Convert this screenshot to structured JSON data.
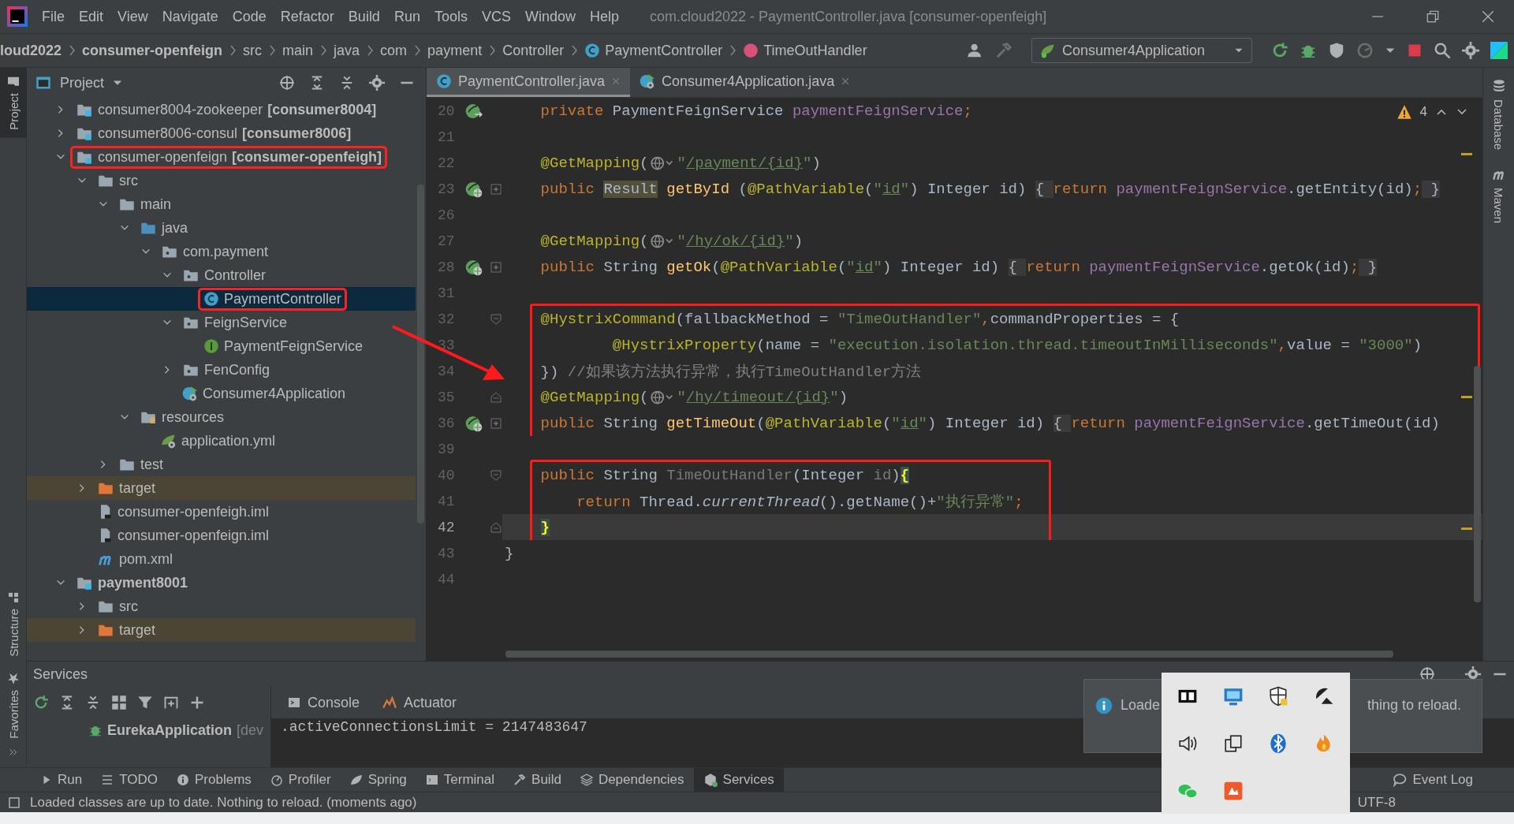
{
  "menu_bar": {
    "menus": [
      "File",
      "Edit",
      "View",
      "Navigate",
      "Code",
      "Refactor",
      "Build",
      "Run",
      "Tools",
      "VCS",
      "Window",
      "Help"
    ],
    "title": "com.cloud2022 - PaymentController.java [consumer-openfeigh]"
  },
  "breadcrumbs": [
    {
      "label": "loud2022",
      "kind": "project"
    },
    {
      "label": "consumer-openfeign",
      "kind": "project"
    },
    {
      "label": "src",
      "kind": "dir"
    },
    {
      "label": "main",
      "kind": "dir"
    },
    {
      "label": "java",
      "kind": "dir"
    },
    {
      "label": "com",
      "kind": "dir"
    },
    {
      "label": "payment",
      "kind": "dir"
    },
    {
      "label": "Controller",
      "kind": "dir"
    },
    {
      "label": "PaymentController",
      "kind": "class"
    },
    {
      "label": "TimeOutHandler",
      "kind": "method"
    }
  ],
  "run_config": {
    "label": "Consumer4Application"
  },
  "side_tabs": {
    "left_top": [
      {
        "label": "Project",
        "selected": true
      }
    ],
    "left_bottom": [
      {
        "label": "Structure",
        "kind": "structure"
      },
      {
        "label": "Favorites",
        "kind": "favorites"
      }
    ],
    "right": [
      {
        "label": "Database",
        "kind": "database"
      },
      {
        "label": "Maven",
        "kind": "maven"
      }
    ]
  },
  "project_panel": {
    "title": "Project",
    "tree": [
      {
        "label": "consumer8004-zookeeper",
        "suffix": "[consumer8004]",
        "kind": "module",
        "expanded": false,
        "selected": false,
        "annotated": false,
        "bold": false
      },
      {
        "label": "consumer8006-consul",
        "suffix": "[consumer8006]",
        "kind": "module",
        "expanded": false,
        "selected": false,
        "annotated": false,
        "bold": false
      },
      {
        "label": "consumer-openfeign",
        "suffix": "[consumer-openfeigh]",
        "kind": "module",
        "expanded": true,
        "selected": false,
        "annotated": true,
        "bold": false,
        "children": [
          {
            "label": "src",
            "kind": "folder",
            "expanded": true,
            "selected": false,
            "annotated": false,
            "bold": false,
            "children": [
              {
                "label": "main",
                "kind": "folder",
                "expanded": true,
                "selected": false,
                "annotated": false,
                "bold": false,
                "children": [
                  {
                    "label": "java",
                    "kind": "source",
                    "expanded": true,
                    "selected": false,
                    "annotated": false,
                    "bold": false,
                    "children": [
                      {
                        "label": "com.payment",
                        "kind": "package",
                        "expanded": true,
                        "selected": false,
                        "annotated": false,
                        "bold": false,
                        "children": [
                          {
                            "label": "Controller",
                            "kind": "package",
                            "expanded": true,
                            "selected": false,
                            "annotated": false,
                            "bold": false,
                            "children": [
                              {
                                "label": "PaymentController",
                                "kind": "class",
                                "selected": true,
                                "annotated": true,
                                "bold": false
                              }
                            ]
                          },
                          {
                            "label": "FeignService",
                            "kind": "package",
                            "expanded": true,
                            "selected": false,
                            "annotated": false,
                            "bold": false,
                            "children": [
                              {
                                "label": "PaymentFeignService",
                                "kind": "interface",
                                "selected": false,
                                "annotated": false,
                                "bold": false
                              }
                            ]
                          },
                          {
                            "label": "FenConfig",
                            "kind": "package",
                            "expanded": false,
                            "selected": false,
                            "annotated": false,
                            "bold": false
                          },
                          {
                            "label": "Consumer4Application",
                            "kind": "spring-app",
                            "selected": false,
                            "annotated": false,
                            "bold": false
                          }
                        ]
                      }
                    ]
                  },
                  {
                    "label": "resources",
                    "kind": "resources",
                    "expanded": true,
                    "selected": false,
                    "annotated": false,
                    "bold": false,
                    "children": [
                      {
                        "label": "application.yml",
                        "kind": "yml",
                        "selected": false,
                        "annotated": false,
                        "bold": false
                      }
                    ]
                  }
                ]
              },
              {
                "label": "test",
                "kind": "folder",
                "expanded": false,
                "selected": false,
                "annotated": false,
                "bold": false
              }
            ]
          },
          {
            "label": "target",
            "kind": "excluded",
            "expanded": false,
            "selected": false,
            "annotated": false,
            "bold": false
          },
          {
            "label": "consumer-openfeigh.iml",
            "kind": "iml",
            "selected": false,
            "annotated": false,
            "bold": false
          },
          {
            "label": "consumer-openfeign.iml",
            "kind": "iml",
            "selected": false,
            "annotated": false,
            "bold": false
          },
          {
            "label": "pom.xml",
            "kind": "maven",
            "selected": false,
            "annotated": false,
            "bold": false
          }
        ]
      },
      {
        "label": "payment8001",
        "kind": "module",
        "expanded": true,
        "selected": false,
        "annotated": false,
        "bold": true,
        "children": [
          {
            "label": "src",
            "kind": "folder",
            "expanded": false,
            "selected": false,
            "annotated": false,
            "bold": false
          },
          {
            "label": "target",
            "kind": "excluded",
            "expanded": false,
            "selected": false,
            "annotated": false,
            "bold": false
          }
        ]
      }
    ]
  },
  "editor": {
    "tabs": [
      {
        "label": "PaymentController.java",
        "kind": "class",
        "selected": true
      },
      {
        "label": "Consumer4Application.java",
        "kind": "spring-app",
        "selected": false
      }
    ],
    "warnings": "4",
    "blocks": [
      {
        "kind": "plain",
        "lines": [
          {
            "number": "20",
            "gutter_icon": {
              "kind": "bean-arrow"
            },
            "current": false,
            "tokens": [
              {
                "text": "    private ",
                "kind": "kw"
              },
              {
                "text": "PaymentFeignService ",
                "kind": "plain"
              },
              {
                "text": "paymentFeignService",
                "kind": "field"
              },
              {
                "text": ";",
                "kind": "kw"
              }
            ]
          },
          {
            "number": "21",
            "current": false
          },
          {
            "number": "22",
            "current": false,
            "tokens": [
              {
                "text": "    @GetMapping",
                "kind": "ann"
              },
              {
                "text": "(",
                "kind": "plain"
              },
              {
                "kind": "globe"
              },
              {
                "text": "\"",
                "kind": "str"
              },
              {
                "text": "/payment/{id}",
                "kind": "url"
              },
              {
                "text": "\"",
                "kind": "str"
              },
              {
                "text": ")",
                "kind": "plain"
              }
            ]
          },
          {
            "number": "23",
            "gutter_icon": {
              "kind": "bean"
            },
            "fold_marker": {
              "kind": "plus"
            },
            "current": false,
            "tokens": [
              {
                "text": "    public ",
                "kind": "kw"
              },
              {
                "text": "Result",
                "kind": "hl"
              },
              {
                "text": " getById ",
                "kind": "method"
              },
              {
                "text": "(",
                "kind": "plain"
              },
              {
                "text": "@PathVariable",
                "kind": "ann"
              },
              {
                "text": "(",
                "kind": "plain"
              },
              {
                "text": "\"",
                "kind": "str"
              },
              {
                "text": "id",
                "kind": "url"
              },
              {
                "text": "\"",
                "kind": "str"
              },
              {
                "text": ") Integer id) ",
                "kind": "plain"
              },
              {
                "text": "{ ",
                "kind": "fold"
              },
              {
                "text": "return ",
                "kind": "kw"
              },
              {
                "text": "paymentFeignService",
                "kind": "field"
              },
              {
                "text": ".getEntity(id)",
                "kind": "plain"
              },
              {
                "text": ";",
                "kind": "kw"
              },
              {
                "text": " }",
                "kind": "fold"
              }
            ]
          },
          {
            "number": "26",
            "current": false
          },
          {
            "number": "27",
            "current": false,
            "tokens": [
              {
                "text": "    @GetMapping",
                "kind": "ann"
              },
              {
                "text": "(",
                "kind": "plain"
              },
              {
                "kind": "globe"
              },
              {
                "text": "\"",
                "kind": "str"
              },
              {
                "text": "/hy/ok/{id}",
                "kind": "url"
              },
              {
                "text": "\"",
                "kind": "str"
              },
              {
                "text": ")",
                "kind": "plain"
              }
            ]
          },
          {
            "number": "28",
            "gutter_icon": {
              "kind": "bean"
            },
            "fold_marker": {
              "kind": "plus"
            },
            "current": false,
            "tokens": [
              {
                "text": "    public ",
                "kind": "kw"
              },
              {
                "text": "String ",
                "kind": "plain"
              },
              {
                "text": "getOk",
                "kind": "method"
              },
              {
                "text": "(",
                "kind": "plain"
              },
              {
                "text": "@PathVariable",
                "kind": "ann"
              },
              {
                "text": "(",
                "kind": "plain"
              },
              {
                "text": "\"",
                "kind": "str"
              },
              {
                "text": "id",
                "kind": "url"
              },
              {
                "text": "\"",
                "kind": "str"
              },
              {
                "text": ") Integer id) ",
                "kind": "plain"
              },
              {
                "text": "{ ",
                "kind": "fold"
              },
              {
                "text": "return ",
                "kind": "kw"
              },
              {
                "text": "paymentFeignService",
                "kind": "field"
              },
              {
                "text": ".getOk(id)",
                "kind": "plain"
              },
              {
                "text": ";",
                "kind": "kw"
              },
              {
                "text": " }",
                "kind": "fold"
              }
            ]
          },
          {
            "number": "31",
            "current": false
          }
        ]
      },
      {
        "kind": "framed-wide",
        "lines": [
          {
            "number": "32",
            "fold_marker": {
              "kind": "start"
            },
            "current": false,
            "tokens": [
              {
                "text": "    @HystrixCommand",
                "kind": "ann"
              },
              {
                "text": "(fallbackMethod = ",
                "kind": "plain"
              },
              {
                "text": "\"TimeOutHandler\"",
                "kind": "str"
              },
              {
                "text": ",",
                "kind": "kw"
              },
              {
                "text": "commandProperties = {",
                "kind": "plain"
              }
            ]
          },
          {
            "number": "33",
            "current": false,
            "tokens": [
              {
                "text": "            @HystrixProperty",
                "kind": "ann"
              },
              {
                "text": "(name = ",
                "kind": "plain"
              },
              {
                "text": "\"execution.isolation.thread.timeoutInMilliseconds\"",
                "kind": "str"
              },
              {
                "text": ",",
                "kind": "kw"
              },
              {
                "text": "value = ",
                "kind": "plain"
              },
              {
                "text": "\"3000\"",
                "kind": "str"
              },
              {
                "text": ")",
                "kind": "plain"
              }
            ]
          },
          {
            "number": "34",
            "current": false,
            "tokens": [
              {
                "text": "    }) ",
                "kind": "plain"
              },
              {
                "text": "//如果该方法执行异常，执行TimeOutHandler方法",
                "kind": "comment"
              }
            ]
          },
          {
            "number": "35",
            "fold_marker": {
              "kind": "end"
            },
            "current": false,
            "tokens": [
              {
                "text": "    @GetMapping",
                "kind": "ann"
              },
              {
                "text": "(",
                "kind": "plain"
              },
              {
                "kind": "globe"
              },
              {
                "text": "\"",
                "kind": "str"
              },
              {
                "text": "/hy/timeout/{id}",
                "kind": "url"
              },
              {
                "text": "\"",
                "kind": "str"
              },
              {
                "text": ")",
                "kind": "plain"
              }
            ]
          },
          {
            "number": "36",
            "gutter_icon": {
              "kind": "bean"
            },
            "fold_marker": {
              "kind": "plus"
            },
            "current": false,
            "tokens": [
              {
                "text": "    public ",
                "kind": "kw"
              },
              {
                "text": "String ",
                "kind": "plain"
              },
              {
                "text": "getTimeOut",
                "kind": "method"
              },
              {
                "text": "(",
                "kind": "plain"
              },
              {
                "text": "@PathVariable",
                "kind": "ann"
              },
              {
                "text": "(",
                "kind": "plain"
              },
              {
                "text": "\"",
                "kind": "str"
              },
              {
                "text": "id",
                "kind": "url"
              },
              {
                "text": "\"",
                "kind": "str"
              },
              {
                "text": ") Integer id) ",
                "kind": "plain"
              },
              {
                "text": "{ ",
                "kind": "fold"
              },
              {
                "text": "return ",
                "kind": "kw"
              },
              {
                "text": "paymentFeignService",
                "kind": "field"
              },
              {
                "text": ".getTimeOut(id)",
                "kind": "plain"
              }
            ]
          }
        ]
      },
      {
        "kind": "plain",
        "lines": [
          {
            "number": "39",
            "current": false
          }
        ]
      },
      {
        "kind": "framed-tight",
        "lines": [
          {
            "number": "40",
            "fold_marker": {
              "kind": "start"
            },
            "current": false,
            "tokens": [
              {
                "text": "    public ",
                "kind": "kw"
              },
              {
                "text": "String ",
                "kind": "plain"
              },
              {
                "text": "TimeOutHandler",
                "kind": "unused"
              },
              {
                "text": "(Integer ",
                "kind": "plain"
              },
              {
                "text": "id",
                "kind": "unused"
              },
              {
                "text": ")",
                "kind": "plain"
              },
              {
                "text": "{",
                "kind": "brace"
              }
            ]
          },
          {
            "number": "41",
            "current": false,
            "tokens": [
              {
                "text": "        return ",
                "kind": "kw"
              },
              {
                "text": "Thread.",
                "kind": "plain"
              },
              {
                "text": "currentThread",
                "kind": "italic"
              },
              {
                "text": "().getName()+",
                "kind": "plain"
              },
              {
                "text": "\"执行异常\"",
                "kind": "str"
              },
              {
                "text": ";",
                "kind": "kw"
              }
            ]
          },
          {
            "number": "42",
            "fold_marker": {
              "kind": "end"
            },
            "current": true,
            "tokens": [
              {
                "text": "    }",
                "kind": "brace"
              }
            ]
          }
        ]
      },
      {
        "kind": "plain",
        "lines": [
          {
            "number": "43",
            "current": false,
            "tokens": [
              {
                "text": "}",
                "kind": "plain"
              }
            ]
          },
          {
            "number": "44",
            "current": false
          }
        ]
      }
    ]
  },
  "services": {
    "title": "Services",
    "tabs": [
      {
        "label": "Console",
        "kind": "console"
      },
      {
        "label": "Actuator",
        "kind": "actuator"
      }
    ],
    "rows": [
      {
        "label": "EurekaApplication",
        "suffix": "[dev"
      }
    ],
    "console": ".activeConnectionsLimit = 2147483647"
  },
  "notification": {
    "start": "Loade",
    "end": "thing to reload."
  },
  "tool_tabs": [
    {
      "label": "Run",
      "kind": "run",
      "selected": false
    },
    {
      "label": "TODO",
      "kind": "todo",
      "selected": false
    },
    {
      "label": "Problems",
      "kind": "problems",
      "selected": false
    },
    {
      "label": "Profiler",
      "kind": "profiler",
      "selected": false
    },
    {
      "label": "Spring",
      "kind": "spring",
      "selected": false
    },
    {
      "label": "Terminal",
      "kind": "terminal",
      "selected": false
    },
    {
      "label": "Build",
      "kind": "build",
      "selected": false
    },
    {
      "label": "Dependencies",
      "kind": "dependencies",
      "selected": false
    },
    {
      "label": "Services",
      "kind": "services",
      "selected": true
    }
  ],
  "event_log": "Event Log",
  "status_bar": {
    "message": "Loaded classes are up to date. Nothing to reload. (moments ago)",
    "encoding": "UTF-8"
  }
}
